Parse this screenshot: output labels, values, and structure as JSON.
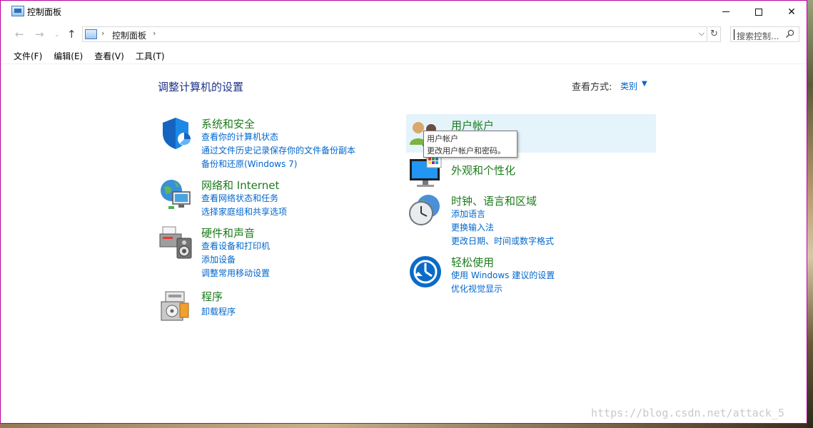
{
  "window": {
    "title": "控制面板",
    "minimize_label": "—",
    "close_label": "✕"
  },
  "nav": {
    "back": "←",
    "forward": "→",
    "recent": "⌄",
    "up": "↑",
    "breadcrumb_sep": "›",
    "address": "控制面板",
    "dropdown": "⌵",
    "refresh": "↻",
    "search_placeholder": "搜索控制...",
    "search_icon_glyph": "⚲"
  },
  "menu": {
    "items": [
      "文件(F)",
      "编辑(E)",
      "查看(V)",
      "工具(T)"
    ]
  },
  "main": {
    "title": "调整计算机的设置",
    "view_label": "查看方式:",
    "view_value": "类别",
    "view_caret": "▼"
  },
  "categories": {
    "system": {
      "title": "系统和安全",
      "links": [
        "查看你的计算机状态",
        "通过文件历史记录保存你的文件备份副本",
        "备份和还原(Windows 7)"
      ]
    },
    "network": {
      "title": "网络和 Internet",
      "links": [
        "查看网络状态和任务",
        "选择家庭组和共享选项"
      ]
    },
    "hardware": {
      "title": "硬件和声音",
      "links": [
        "查看设备和打印机",
        "添加设备",
        "调整常用移动设置"
      ]
    },
    "programs": {
      "title": "程序",
      "links": [
        "卸载程序"
      ]
    },
    "user": {
      "title": "用户帐户"
    },
    "appearance": {
      "title": "外观和个性化"
    },
    "clock": {
      "title": "时钟、语言和区域",
      "links": [
        "添加语言",
        "更换输入法",
        "更改日期、时间或数字格式"
      ]
    },
    "ease": {
      "title": "轻松使用",
      "links": [
        "使用 Windows 建议的设置",
        "优化视觉显示"
      ]
    }
  },
  "tooltip": {
    "line1": "用户帐户",
    "line2": "更改用户帐户和密码。"
  },
  "watermark": "https://blog.csdn.net/attack_5",
  "colors": {
    "link": "#0066cc",
    "category_title": "#1d7b1d",
    "page_title": "#1e3287",
    "hover_bg": "#e5f3fb",
    "window_border": "#b5009a"
  }
}
